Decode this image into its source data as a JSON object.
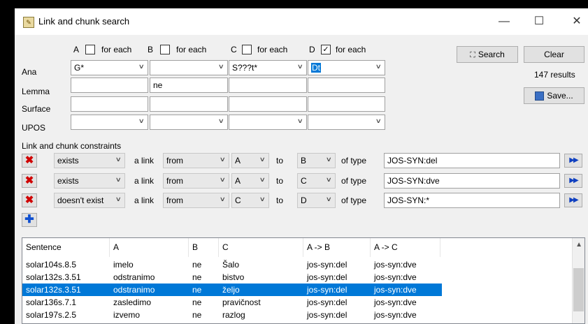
{
  "window": {
    "title": "Link and chunk search",
    "app_icon": "app-icon"
  },
  "columns": {
    "A": {
      "letter": "A",
      "foreach_label": "for each",
      "checked": false
    },
    "B": {
      "letter": "B",
      "foreach_label": "for each",
      "checked": false
    },
    "C": {
      "letter": "C",
      "foreach_label": "for each",
      "checked": false
    },
    "D": {
      "letter": "D",
      "foreach_label": "for each",
      "checked": true,
      "check_mark": "✓"
    }
  },
  "rows": {
    "ana": "Ana",
    "lemma": "Lemma",
    "surface": "Surface",
    "upos": "UPOS"
  },
  "fields": {
    "ana": {
      "A": "G*",
      "B": "",
      "C": "S???t*",
      "D": "Dt"
    },
    "lemma": {
      "A": "",
      "B": "ne",
      "C": "",
      "D": ""
    },
    "surface": {
      "A": "",
      "B": "",
      "C": "",
      "D": ""
    },
    "upos": {
      "A": "",
      "B": "",
      "C": "",
      "D": ""
    }
  },
  "actions": {
    "search": "Search",
    "clear": "Clear",
    "results": "147 results",
    "save": "Save..."
  },
  "constraints": {
    "heading": "Link and chunk constraints",
    "a_link": "a link",
    "to": "to",
    "of_type": "of type",
    "items": [
      {
        "exists": "exists",
        "from": "from",
        "src": "A",
        "dst": "B",
        "type": "JOS-SYN:del"
      },
      {
        "exists": "exists",
        "from": "from",
        "src": "A",
        "dst": "C",
        "type": "JOS-SYN:dve"
      },
      {
        "exists": "doesn't exist",
        "from": "from",
        "src": "C",
        "dst": "D",
        "type": "JOS-SYN:*"
      }
    ]
  },
  "results": {
    "headers": [
      "Sentence",
      "A",
      "B",
      "C",
      "A -> B",
      "A -> C"
    ],
    "rows": [
      [
        "solar104s.8.5",
        "imelo",
        "ne",
        "Šalo",
        "jos-syn:del",
        "jos-syn:dve"
      ],
      [
        "solar132s.3.51",
        "odstranimo",
        "ne",
        "bistvo",
        "jos-syn:del",
        "jos-syn:dve"
      ],
      [
        "solar132s.3.51",
        "odstranimo",
        "ne",
        "željo",
        "jos-syn:del",
        "jos-syn:dve"
      ],
      [
        "solar136s.7.1",
        "zasledimo",
        "ne",
        "pravičnost",
        "jos-syn:del",
        "jos-syn:dve"
      ],
      [
        "solar197s.2.5",
        "izvemo",
        "ne",
        "razlog",
        "jos-syn:del",
        "jos-syn:dve"
      ]
    ],
    "selected_row": 2
  },
  "colors": {
    "selection": "#0078d7",
    "remove": "#d00000",
    "accent": "#1040c0"
  }
}
